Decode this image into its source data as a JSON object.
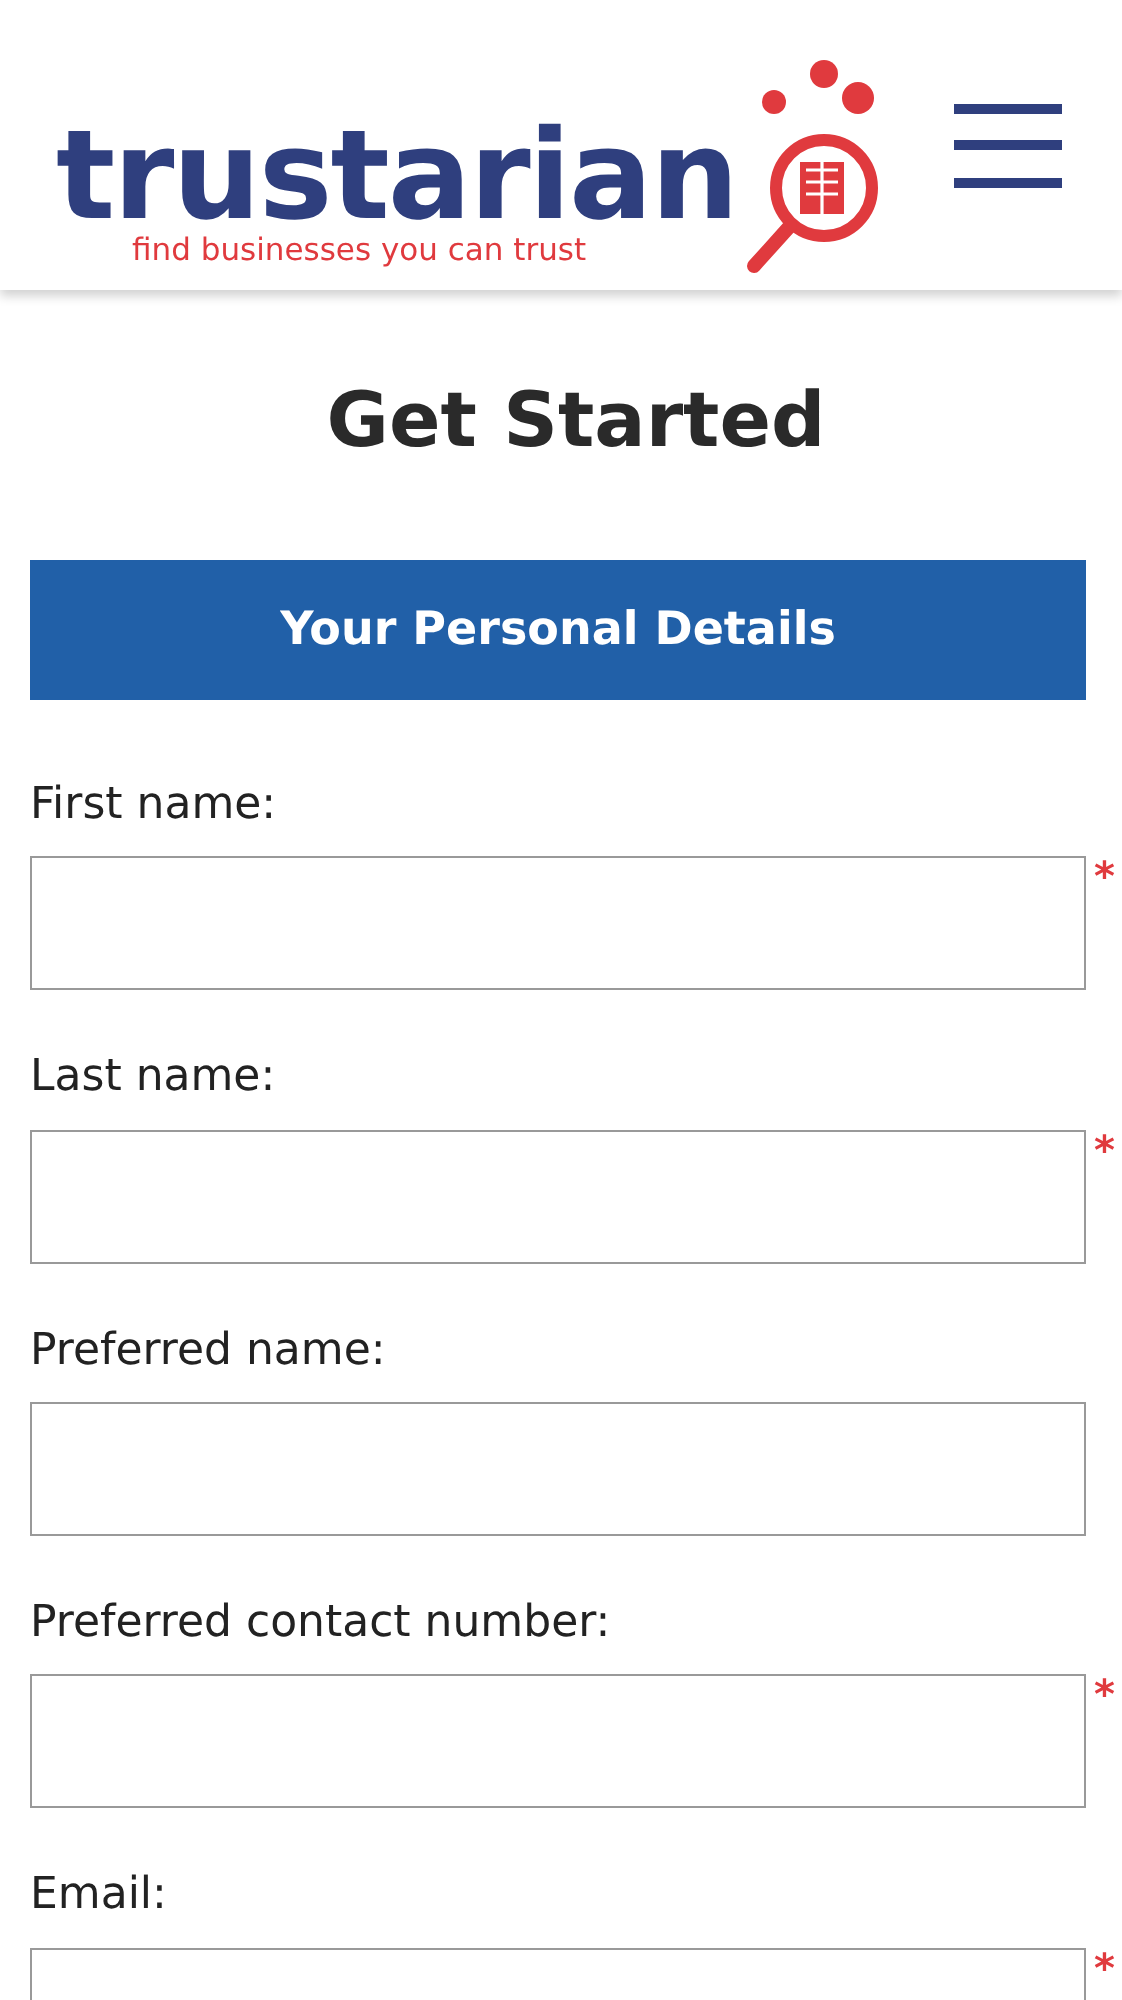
{
  "header": {
    "logo": {
      "name": "trustarian",
      "tagline": "find businesses you can trust"
    }
  },
  "title": "Get Started",
  "section": {
    "title": "Your Personal Details"
  },
  "form": {
    "fields": [
      {
        "label": "First name:",
        "required": true,
        "required_mark": "*"
      },
      {
        "label": "Last name:",
        "required": true,
        "required_mark": "*"
      },
      {
        "label": "Preferred name:",
        "required": false
      },
      {
        "label": "Preferred contact number:",
        "required": true,
        "required_mark": "*"
      },
      {
        "label": "Email:",
        "required": true,
        "required_mark": "*"
      }
    ]
  }
}
